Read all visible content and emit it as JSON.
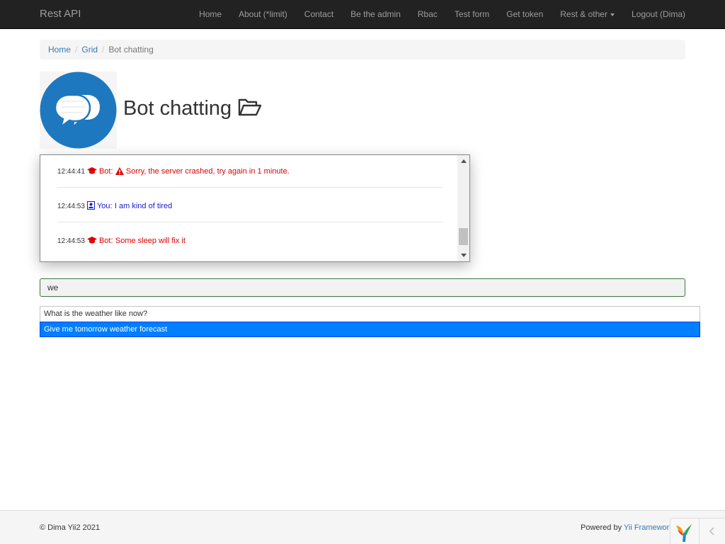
{
  "navbar": {
    "brand": "Rest API",
    "items": [
      {
        "label": "Home"
      },
      {
        "label": "About (*limit)"
      },
      {
        "label": "Contact"
      },
      {
        "label": "Be the admin"
      },
      {
        "label": "Rbac"
      },
      {
        "label": "Test form"
      },
      {
        "label": "Get token"
      },
      {
        "label": "Rest & other"
      },
      {
        "label": "Logout (Dima)"
      }
    ]
  },
  "breadcrumb": {
    "items": [
      "Home",
      "Grid"
    ],
    "active": "Bot chatting",
    "separator": "/"
  },
  "page": {
    "title": "Bot chatting",
    "logo_icon": "chat-bubbles-icon",
    "title_icon": "folder-open-icon"
  },
  "chat": {
    "messages": [
      {
        "time": "12:44:41",
        "sender": "Bot:",
        "text": "Sorry, the server crashed, try again in 1 minute.",
        "type": "bot",
        "warning": true
      },
      {
        "time": "12:44:53",
        "sender": "You:",
        "text": "I am kind of tired",
        "type": "user"
      },
      {
        "time": "12:44:53",
        "sender": "Bot:",
        "text": "Some sleep will fix it",
        "type": "bot"
      }
    ]
  },
  "input": {
    "value": "we"
  },
  "autocomplete": {
    "options": [
      {
        "label": "What is the weather like now?",
        "active": false
      },
      {
        "label": "Give me tomorrow weather forecast",
        "active": true
      }
    ]
  },
  "footer": {
    "copyright": "© Dima Yii2 2021",
    "powered_prefix": "Powered by ",
    "powered_link": "Yii Framework"
  },
  "colors": {
    "navbar_bg": "#222222",
    "link": "#337ab7",
    "bot_text": "#e00000",
    "user_text": "#1a1acc",
    "autocomplete_active": "#007fff"
  }
}
